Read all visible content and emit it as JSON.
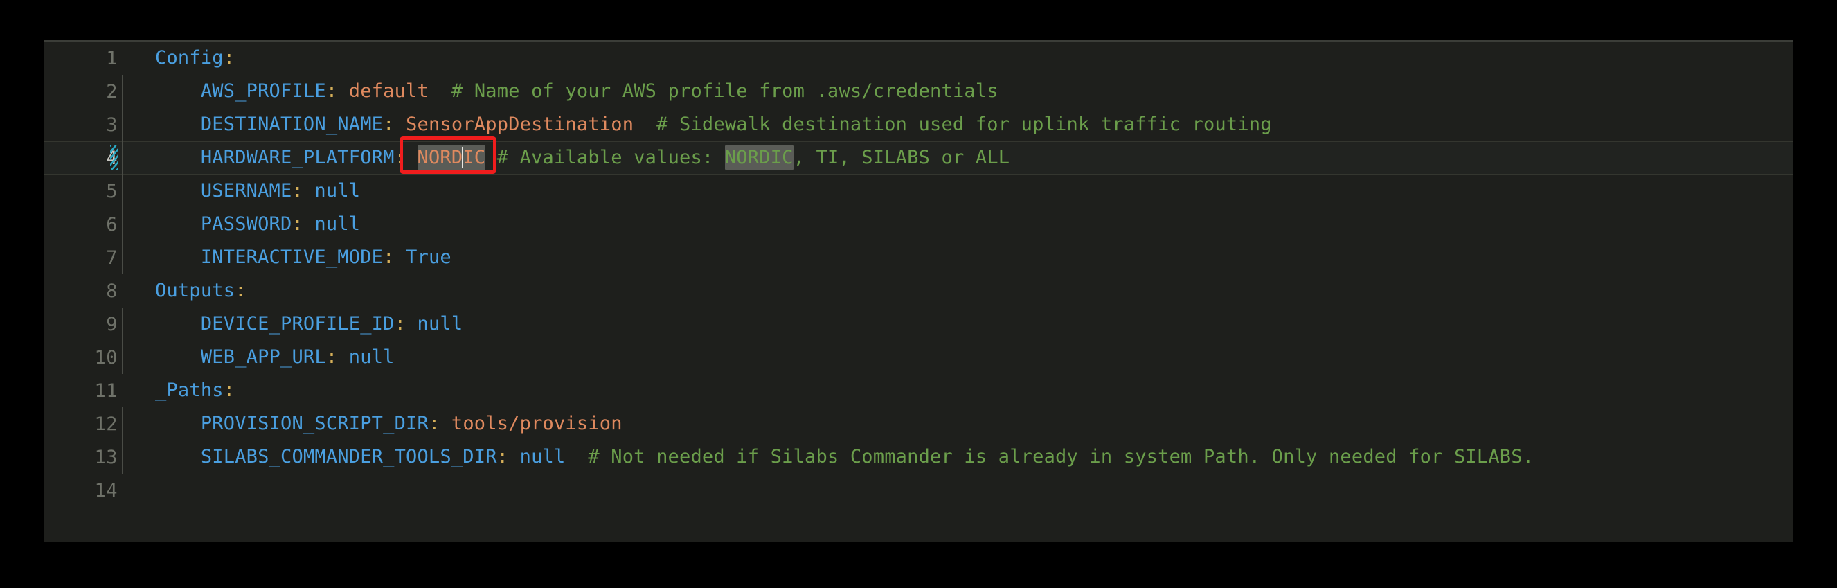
{
  "editor": {
    "file_type": "yaml",
    "theme": "dark",
    "colors": {
      "background": "#1e1f1c",
      "page_background": "#000000",
      "line_number": "#6f7269",
      "line_number_active": "#c8c8c2",
      "key": "#4a9fe0",
      "punctuation": "#d6b05a",
      "string": "#e08a5f",
      "constant": "#4a9fe0",
      "comment": "#6b9e4b",
      "word_highlight": "#5a5c57",
      "caret": "#e8e8e4",
      "annotation_box": "#f01d1d",
      "modified_marker": "#2aa9c4",
      "indent_guide": "#4a4c46",
      "active_line_background": "#212320"
    },
    "active_line": 4,
    "cursor": {
      "line": 4,
      "column_after_text": "NORD"
    },
    "modified_lines": [
      4
    ],
    "annotation": {
      "type": "red-rectangle",
      "target_line": 4,
      "target_text": "NORDIC"
    },
    "lines": [
      {
        "number": "1",
        "indent": 0,
        "guide": false,
        "tokens": [
          {
            "t": "Config",
            "c": "key"
          },
          {
            "t": ":",
            "c": "punct"
          }
        ]
      },
      {
        "number": "2",
        "indent": 1,
        "guide": true,
        "tokens": [
          {
            "t": "    ",
            "c": "plain"
          },
          {
            "t": "AWS_PROFILE",
            "c": "key"
          },
          {
            "t": ":",
            "c": "punct"
          },
          {
            "t": " ",
            "c": "plain"
          },
          {
            "t": "default",
            "c": "str"
          },
          {
            "t": "  ",
            "c": "plain"
          },
          {
            "t": "# Name of your AWS profile from .aws/credentials",
            "c": "cmt"
          }
        ]
      },
      {
        "number": "3",
        "indent": 1,
        "guide": true,
        "tokens": [
          {
            "t": "    ",
            "c": "plain"
          },
          {
            "t": "DESTINATION_NAME",
            "c": "key"
          },
          {
            "t": ":",
            "c": "punct"
          },
          {
            "t": " ",
            "c": "plain"
          },
          {
            "t": "SensorAppDestination",
            "c": "str"
          },
          {
            "t": "  ",
            "c": "plain"
          },
          {
            "t": "# Sidewalk destination used for uplink traffic routing",
            "c": "cmt"
          }
        ]
      },
      {
        "number": "4",
        "indent": 1,
        "guide": true,
        "active": true,
        "modified": true,
        "tokens": [
          {
            "t": "    ",
            "c": "plain"
          },
          {
            "t": "HARDWARE_PLATFORM",
            "c": "key"
          },
          {
            "t": ":",
            "c": "punct"
          },
          {
            "t": " ",
            "c": "plain"
          },
          {
            "t": "NORD",
            "c": "str",
            "hl": true
          },
          {
            "t": "",
            "c": "caret"
          },
          {
            "t": "IC",
            "c": "str",
            "hl": true
          },
          {
            "t": " ",
            "c": "plain"
          },
          {
            "t": "# Available values: ",
            "c": "cmt"
          },
          {
            "t": "NORDIC",
            "c": "cmt",
            "hl": true
          },
          {
            "t": ", TI, SILABS or ALL",
            "c": "cmt"
          }
        ]
      },
      {
        "number": "5",
        "indent": 1,
        "guide": true,
        "tokens": [
          {
            "t": "    ",
            "c": "plain"
          },
          {
            "t": "USERNAME",
            "c": "key"
          },
          {
            "t": ":",
            "c": "punct"
          },
          {
            "t": " ",
            "c": "plain"
          },
          {
            "t": "null",
            "c": "const"
          }
        ]
      },
      {
        "number": "6",
        "indent": 1,
        "guide": true,
        "tokens": [
          {
            "t": "    ",
            "c": "plain"
          },
          {
            "t": "PASSWORD",
            "c": "key"
          },
          {
            "t": ":",
            "c": "punct"
          },
          {
            "t": " ",
            "c": "plain"
          },
          {
            "t": "null",
            "c": "const"
          }
        ]
      },
      {
        "number": "7",
        "indent": 1,
        "guide": true,
        "tokens": [
          {
            "t": "    ",
            "c": "plain"
          },
          {
            "t": "INTERACTIVE_MODE",
            "c": "key"
          },
          {
            "t": ":",
            "c": "punct"
          },
          {
            "t": " ",
            "c": "plain"
          },
          {
            "t": "True",
            "c": "const"
          }
        ]
      },
      {
        "number": "8",
        "indent": 0,
        "guide": false,
        "tokens": [
          {
            "t": "Outputs",
            "c": "key"
          },
          {
            "t": ":",
            "c": "punct"
          }
        ]
      },
      {
        "number": "9",
        "indent": 1,
        "guide": true,
        "tokens": [
          {
            "t": "    ",
            "c": "plain"
          },
          {
            "t": "DEVICE_PROFILE_ID",
            "c": "key"
          },
          {
            "t": ":",
            "c": "punct"
          },
          {
            "t": " ",
            "c": "plain"
          },
          {
            "t": "null",
            "c": "const"
          }
        ]
      },
      {
        "number": "10",
        "indent": 1,
        "guide": true,
        "tokens": [
          {
            "t": "    ",
            "c": "plain"
          },
          {
            "t": "WEB_APP_URL",
            "c": "key"
          },
          {
            "t": ":",
            "c": "punct"
          },
          {
            "t": " ",
            "c": "plain"
          },
          {
            "t": "null",
            "c": "const"
          }
        ]
      },
      {
        "number": "11",
        "indent": 0,
        "guide": false,
        "tokens": [
          {
            "t": "_Paths",
            "c": "key"
          },
          {
            "t": ":",
            "c": "punct"
          }
        ]
      },
      {
        "number": "12",
        "indent": 1,
        "guide": true,
        "tokens": [
          {
            "t": "    ",
            "c": "plain"
          },
          {
            "t": "PROVISION_SCRIPT_DIR",
            "c": "key"
          },
          {
            "t": ":",
            "c": "punct"
          },
          {
            "t": " ",
            "c": "plain"
          },
          {
            "t": "tools/provision",
            "c": "str"
          }
        ]
      },
      {
        "number": "13",
        "indent": 1,
        "guide": true,
        "tokens": [
          {
            "t": "    ",
            "c": "plain"
          },
          {
            "t": "SILABS_COMMANDER_TOOLS_DIR",
            "c": "key"
          },
          {
            "t": ":",
            "c": "punct"
          },
          {
            "t": " ",
            "c": "plain"
          },
          {
            "t": "null",
            "c": "const"
          },
          {
            "t": "  ",
            "c": "plain"
          },
          {
            "t": "# Not needed if Silabs Commander is already in system Path. Only needed for SILABS.",
            "c": "cmt"
          }
        ]
      },
      {
        "number": "14",
        "indent": 0,
        "guide": false,
        "tokens": []
      }
    ]
  }
}
